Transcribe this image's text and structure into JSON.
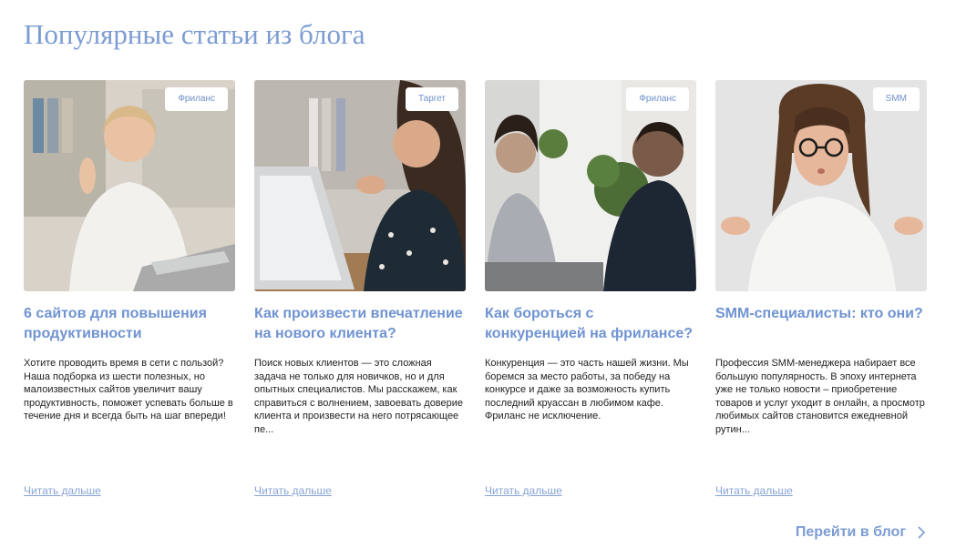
{
  "section_title": "Популярные статьи из блога",
  "articles": [
    {
      "tag": "Фриланс",
      "title": "6 сайтов для повышения продуктивности",
      "excerpt": "Хотите проводить время в сети с пользой? Наша подборка из шести полезных, но малоизвестных сайтов увеличит вашу продуктивность, поможет успевать больше в течение дня и всегда быть на шаг впереди!",
      "read_more": "Читать дальше"
    },
    {
      "tag": "Таргет",
      "title": "Как произвести впечатление на нового клиента?",
      "excerpt": "Поиск новых клиентов — это сложная задача не только для новичков, но и для опытных специалистов. Мы расскажем, как справиться с волнением, завоевать доверие клиента и произвести на него потрясающее пе...",
      "read_more": "Читать дальше"
    },
    {
      "tag": "Фриланс",
      "title": "Как бороться с конкуренцией на фрилансе?",
      "excerpt": "Конкуренция — это часть нашей жизни. Мы боремся за место работы, за победу на конкурсе и даже за возможность купить последний круассан в любимом кафе. Фриланс не исключение.",
      "read_more": "Читать дальше"
    },
    {
      "tag": "SMM",
      "title": "SMM-специалисты: кто они?",
      "excerpt": "Профессия SMM-менеджера набирает все большую популярность. В эпоху интернета уже не только новости – приобретение товаров и услуг уходит в онлайн, а просмотр любимых сайтов становится ежедневной рутин...",
      "read_more": "Читать дальше"
    }
  ],
  "blog_link": "Перейти в блог",
  "icons": {
    "blog_link": "chevron-right-icon"
  },
  "colors": {
    "accent": "#7c9cd3",
    "text": "#222222"
  }
}
